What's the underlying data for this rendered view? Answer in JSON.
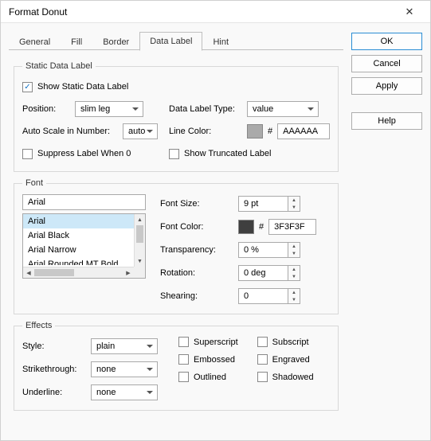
{
  "title": "Format Donut",
  "tabs": [
    "General",
    "Fill",
    "Border",
    "Data Label",
    "Hint"
  ],
  "active_tab": "Data Label",
  "buttons": {
    "ok": "OK",
    "cancel": "Cancel",
    "apply": "Apply",
    "help": "Help"
  },
  "static_label": {
    "legend": "Static Data Label",
    "show_cb": "Show Static Data Label",
    "show_checked": true,
    "position_label": "Position:",
    "position_value": "slim leg",
    "type_label": "Data Label Type:",
    "type_value": "value",
    "autoscale_label": "Auto Scale in Number:",
    "autoscale_value": "auto",
    "linecolor_label": "Line Color:",
    "linecolor_swatch": "#AAAAAA",
    "linecolor_hash": "#",
    "linecolor_hex": "AAAAAA",
    "suppress_cb": "Suppress Label When 0",
    "truncated_cb": "Show Truncated Label"
  },
  "font": {
    "legend": "Font",
    "name_value": "Arial",
    "list": [
      "Arial",
      "Arial Black",
      "Arial Narrow",
      "Arial Rounded MT Bold"
    ],
    "size_label": "Font Size:",
    "size_value": "9 pt",
    "color_label": "Font Color:",
    "color_swatch": "#3F3F3F",
    "color_hash": "#",
    "color_hex": "3F3F3F",
    "transparency_label": "Transparency:",
    "transparency_value": "0 %",
    "rotation_label": "Rotation:",
    "rotation_value": "0 deg",
    "shearing_label": "Shearing:",
    "shearing_value": "0"
  },
  "effects": {
    "legend": "Effects",
    "style_label": "Style:",
    "style_value": "plain",
    "strike_label": "Strikethrough:",
    "strike_value": "none",
    "underline_label": "Underline:",
    "underline_value": "none",
    "superscript": "Superscript",
    "subscript": "Subscript",
    "embossed": "Embossed",
    "engraved": "Engraved",
    "outlined": "Outlined",
    "shadowed": "Shadowed"
  }
}
